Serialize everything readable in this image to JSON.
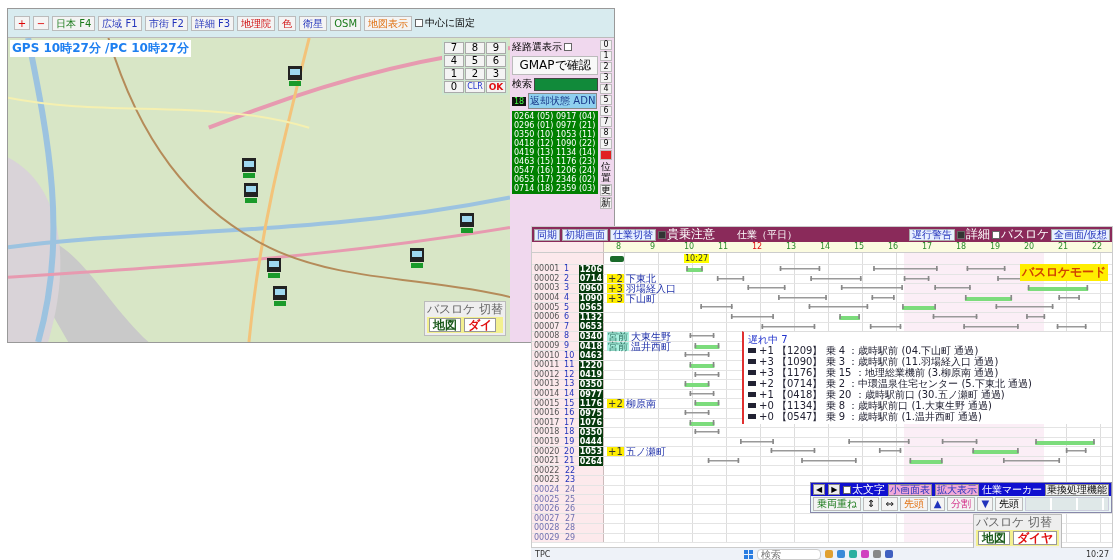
{
  "map_window": {
    "toolbar": {
      "zoom_buttons": [
        "+",
        "−"
      ],
      "buttons": [
        {
          "label": "日本 F4",
          "kind": "green"
        },
        {
          "label": "広域 F1",
          "kind": "blue"
        },
        {
          "label": "市街 F2",
          "kind": "blue"
        },
        {
          "label": "詳細 F3",
          "kind": "blue"
        },
        {
          "label": "地理院",
          "kind": "red"
        },
        {
          "label": "色",
          "kind": "red"
        },
        {
          "label": "衛星",
          "kind": "blue"
        },
        {
          "label": "OSM",
          "kind": "green"
        },
        {
          "label": "地図表示",
          "kind": "orange"
        }
      ],
      "pin": {
        "label": "中心に固定",
        "checked": false
      }
    },
    "clock": "GPS 10時27分 /PC 10時27分",
    "keypad": [
      {
        "label": "7",
        "kind": "digit"
      },
      {
        "label": "8",
        "kind": "digit"
      },
      {
        "label": "9",
        "kind": "digit"
      },
      {
        "label": "4",
        "kind": "digit"
      },
      {
        "label": "5",
        "kind": "digit"
      },
      {
        "label": "6",
        "kind": "digit"
      },
      {
        "label": "1",
        "kind": "digit"
      },
      {
        "label": "2",
        "kind": "digit"
      },
      {
        "label": "3",
        "kind": "digit"
      },
      {
        "label": "0",
        "kind": "digit"
      },
      {
        "label": "CLR",
        "kind": "clear"
      },
      {
        "label": "OK",
        "kind": "ok"
      }
    ],
    "side_panel": {
      "route_toggle": {
        "label": "経路選表示",
        "checked": false
      },
      "gmap_button": "GMAPで確認",
      "search_label": "検索",
      "count": "18",
      "status_button": "返却状態 ADN",
      "buses": [
        "0264 (05)",
        "0296 (01)",
        "0350 (10)",
        "0418 (12)",
        "0419 (13)",
        "0463 (15)",
        "0547 (16)",
        "0653 (17)",
        "0714 (18)",
        "0917 (04)",
        "0977 (21)",
        "1053 (11)",
        "1090 (22)",
        "1134 (14)",
        "1176 (23)",
        "1206 (24)",
        "2346 (02)",
        "2359 (03)"
      ],
      "number_buttons": [
        "0",
        "1",
        "2",
        "3",
        "4",
        "5",
        "6",
        "7",
        "8",
        "9"
      ],
      "position_label": "位置",
      "update_buttons": [
        "更",
        "新"
      ]
    },
    "mode_switch": {
      "title": "バスロケ 切替",
      "buttons": [
        {
          "label": "地図",
          "kind": "map"
        },
        {
          "label": "ダイ",
          "kind": "diagram"
        }
      ]
    }
  },
  "diagram_window": {
    "title": "仕業（平日）",
    "toolbar_left": [
      "同期",
      "初期画面",
      "仕業切替"
    ],
    "options": [
      {
        "label": "貴乗注意",
        "checked": true
      },
      {
        "label": "詳細",
        "checked": true
      },
      {
        "label": "バスロケ",
        "checked": false
      }
    ],
    "toolbar_right": [
      "遅行警告",
      "全画面/仮想"
    ],
    "hours": [
      {
        "label": "8",
        "accent": false
      },
      {
        "label": "9",
        "accent": false
      },
      {
        "label": "10",
        "accent": false
      },
      {
        "label": "11",
        "accent": false
      },
      {
        "label": "12",
        "accent": true
      },
      {
        "label": "13",
        "accent": false
      },
      {
        "label": "14",
        "accent": false
      },
      {
        "label": "15",
        "accent": false
      },
      {
        "label": "16",
        "accent": false
      },
      {
        "label": "17",
        "accent": false
      },
      {
        "label": "18",
        "accent": false
      },
      {
        "label": "19",
        "accent": false
      },
      {
        "label": "20",
        "accent": false
      },
      {
        "label": "21",
        "accent": false
      },
      {
        "label": "22",
        "accent": false
      }
    ],
    "now_marker": "10:27",
    "mode_label": "バスロケモード",
    "rows": [
      {
        "id": "00001",
        "no": "1",
        "bus": "1206",
        "inactive": false
      },
      {
        "id": "00002",
        "no": "2",
        "bus": "0714",
        "inactive": false,
        "note": {
          "kind": "delay",
          "tag": "+2",
          "stop": "下東北"
        }
      },
      {
        "id": "00003",
        "no": "3",
        "bus": "0960",
        "inactive": false,
        "note": {
          "kind": "delay",
          "tag": "+3",
          "stop": "羽場経入口"
        }
      },
      {
        "id": "00004",
        "no": "4",
        "bus": "1090",
        "inactive": false,
        "note": {
          "kind": "delay",
          "tag": "+3",
          "stop": "下山町"
        }
      },
      {
        "id": "00005",
        "no": "5",
        "bus": "0565",
        "inactive": false
      },
      {
        "id": "00006",
        "no": "6",
        "bus": "1132",
        "inactive": false
      },
      {
        "id": "00007",
        "no": "7",
        "bus": "0653",
        "inactive": false
      },
      {
        "id": "00008",
        "no": "8",
        "bus": "0340",
        "inactive": false,
        "note": {
          "kind": "place",
          "tag": "宮前",
          "stop": "大東生野"
        }
      },
      {
        "id": "00009",
        "no": "9",
        "bus": "0418",
        "inactive": false,
        "note": {
          "kind": "place",
          "tag": "宮前",
          "stop": "温井西町"
        }
      },
      {
        "id": "00010",
        "no": "10",
        "bus": "0463",
        "inactive": false
      },
      {
        "id": "00011",
        "no": "11",
        "bus": "1220",
        "inactive": false
      },
      {
        "id": "00012",
        "no": "12",
        "bus": "0419",
        "inactive": false
      },
      {
        "id": "00013",
        "no": "13",
        "bus": "0350",
        "inactive": false
      },
      {
        "id": "00014",
        "no": "14",
        "bus": "0977",
        "inactive": false
      },
      {
        "id": "00015",
        "no": "15",
        "bus": "1176",
        "inactive": false,
        "note": {
          "kind": "delay",
          "tag": "+2",
          "stop": "柳原南"
        }
      },
      {
        "id": "00016",
        "no": "16",
        "bus": "0975",
        "inactive": false
      },
      {
        "id": "00017",
        "no": "17",
        "bus": "1076",
        "inactive": false
      },
      {
        "id": "00018",
        "no": "18",
        "bus": "0350",
        "inactive": false
      },
      {
        "id": "00019",
        "no": "19",
        "bus": "0444",
        "inactive": false
      },
      {
        "id": "00020",
        "no": "20",
        "bus": "1053",
        "inactive": false,
        "note": {
          "kind": "delay",
          "tag": "+1",
          "stop": "五ノ瀬町"
        }
      },
      {
        "id": "00021",
        "no": "21",
        "bus": "0264",
        "inactive": false
      },
      {
        "id": "00022",
        "no": "22",
        "inactive": false
      },
      {
        "id": "00023",
        "no": "23",
        "inactive": false
      },
      {
        "id": "00024",
        "no": "24",
        "inactive": true
      },
      {
        "id": "00025",
        "no": "25",
        "inactive": true
      },
      {
        "id": "00026",
        "no": "26",
        "inactive": true
      },
      {
        "id": "00027",
        "no": "27",
        "inactive": true
      },
      {
        "id": "00028",
        "no": "28",
        "inactive": true
      },
      {
        "id": "00029",
        "no": "29",
        "inactive": true
      }
    ],
    "delay_list": {
      "header": "遅れ中 7",
      "items": [
        "+1 【1209】 乗 4 ：歳時駅前 (04.下山町 通過)",
        "+3 【1090】 乗 3 ：歳時駅前 (11.羽場経入口 通過)",
        "+3 【1176】 乗 15 ：地理総業機前 (3.柳原南 通過)",
        "+2 【0714】 乗 2 ：中環温泉住宅センター (5.下東北 通過)",
        "+1 【0418】 乗 20 ：歳時駅前口 (30.五ノ瀬町 通過)",
        "+0 【1134】 乗 8 ：歳時駅前口 (1.大東生野 通過)",
        "+0 【0547】 乗 9 ：歳時駅前 (1.温井西町 通過)"
      ]
    },
    "control_panel": {
      "nav": [
        "◀",
        "▶"
      ],
      "bold": {
        "label": "太文字",
        "checked": false
      },
      "buttons": [
        "小画面表",
        "拡大表示"
      ],
      "marker_label": "仕業マーカー",
      "transfer_button": "乗換処理機能",
      "tools": [
        {
          "label": "乗両重ね",
          "kind": "green"
        },
        {
          "label": "⇕",
          "kind": "plain"
        },
        {
          "label": "⇔",
          "kind": "plain"
        },
        {
          "label": "先頭",
          "kind": "orange"
        },
        {
          "label": "▲",
          "kind": "blue"
        },
        {
          "label": "分割",
          "kind": "pink"
        },
        {
          "label": "▼",
          "kind": "blue"
        },
        {
          "label": "先頭",
          "kind": "plain"
        }
      ]
    },
    "mode_switch": {
      "title": "バスロケ 切替",
      "buttons": [
        {
          "label": "地図",
          "kind": "map"
        },
        {
          "label": "ダイヤ",
          "kind": "diagram"
        }
      ]
    }
  },
  "taskbar": {
    "app_label": "TPC",
    "search_placeholder": "検索",
    "clock": "10:27"
  }
}
